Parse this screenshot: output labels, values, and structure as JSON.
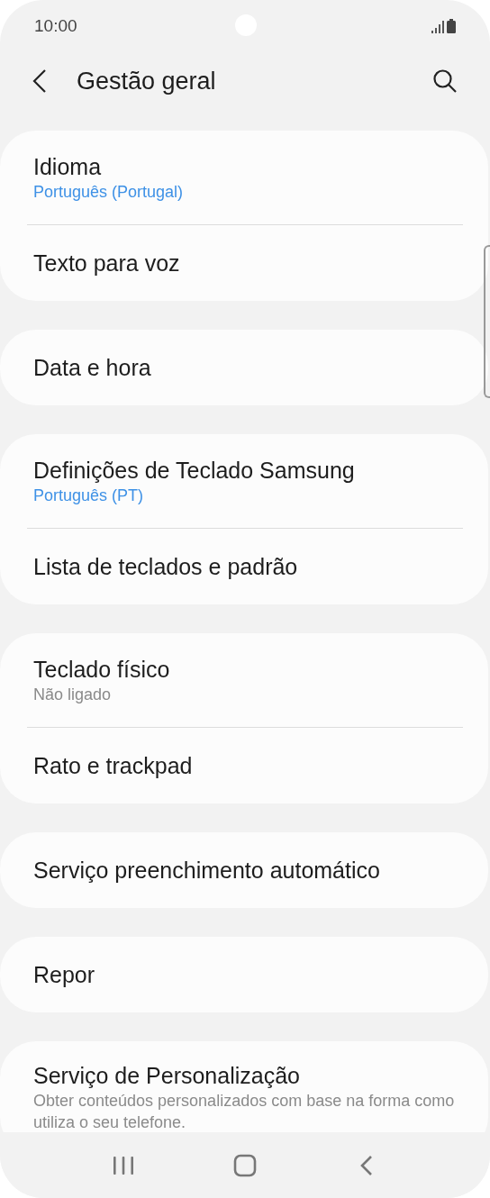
{
  "status_bar": {
    "time": "10:00"
  },
  "header": {
    "title": "Gestão geral"
  },
  "groups": [
    {
      "items": [
        {
          "title": "Idioma",
          "subtitle": "Português (Portugal)",
          "kind": "value"
        },
        {
          "title": "Texto para voz"
        }
      ]
    },
    {
      "items": [
        {
          "title": "Data e hora"
        }
      ]
    },
    {
      "items": [
        {
          "title": "Definições de Teclado Samsung",
          "subtitle": "Português (PT)",
          "kind": "value"
        },
        {
          "title": "Lista de teclados e padrão"
        }
      ]
    },
    {
      "items": [
        {
          "title": "Teclado físico",
          "subtitle": "Não ligado",
          "kind": "summary"
        },
        {
          "title": "Rato e trackpad"
        }
      ]
    },
    {
      "items": [
        {
          "title": "Serviço preenchimento automático"
        }
      ]
    },
    {
      "items": [
        {
          "title": "Repor"
        }
      ]
    },
    {
      "items": [
        {
          "title": "Serviço de Personalização",
          "subtitle": "Obter conteúdos personalizados com base na forma como utiliza o seu telefone.",
          "kind": "summary"
        }
      ]
    }
  ]
}
